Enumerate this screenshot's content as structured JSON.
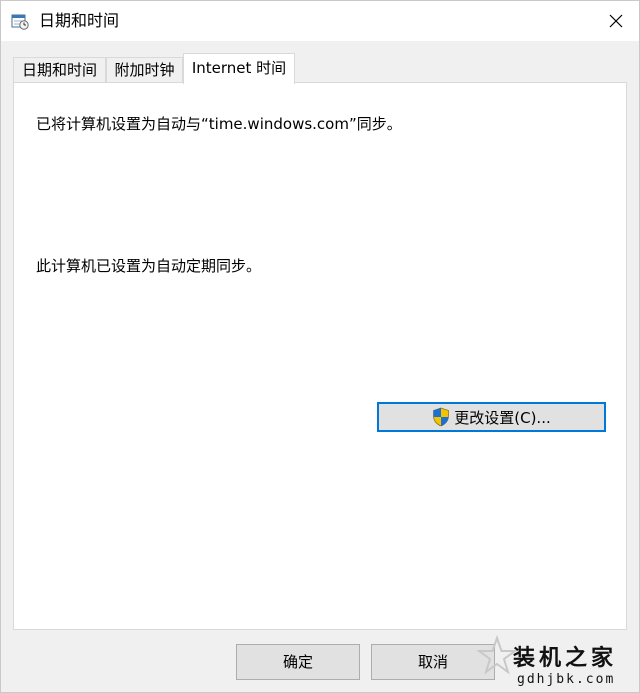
{
  "window": {
    "title": "日期和时间",
    "close_icon": "close-icon"
  },
  "tabs": [
    {
      "label": "日期和时间",
      "active": false
    },
    {
      "label": "附加时钟",
      "active": false
    },
    {
      "label": "Internet 时间",
      "active": true
    }
  ],
  "panel": {
    "sync_message": "已将计算机设置为自动与“time.windows.com”同步。",
    "schedule_message": "此计算机已设置为自动定期同步。",
    "change_settings_label": "更改设置(C)...",
    "change_settings_icon": "uac-shield-icon"
  },
  "footer": {
    "ok_label": "确定",
    "cancel_label": "取消"
  },
  "watermark": {
    "name": "装机之家",
    "url": "gdhjbk.com"
  },
  "colors": {
    "accent": "#0078d7",
    "button_face": "#e1e1e1",
    "window_bg": "#f0f0f0"
  }
}
